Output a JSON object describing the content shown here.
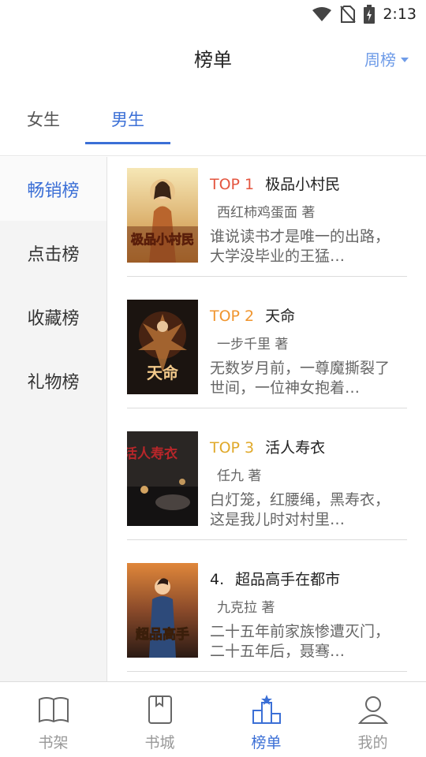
{
  "status_bar": {
    "time": "2:13"
  },
  "header": {
    "title": "榜单",
    "period": "周榜"
  },
  "gender_tabs": [
    {
      "label": "女生",
      "active": false
    },
    {
      "label": "男生",
      "active": true
    }
  ],
  "sidebar": [
    {
      "label": "畅销榜",
      "active": true
    },
    {
      "label": "点击榜",
      "active": false
    },
    {
      "label": "收藏榜",
      "active": false
    },
    {
      "label": "礼物榜",
      "active": false
    }
  ],
  "books": [
    {
      "rank": "TOP 1",
      "rank_color": "#e4553f",
      "title": "极品小村民",
      "author": "西红柿鸡蛋面 著",
      "desc": "谁说读书才是唯一的出路，大学没毕业的王猛…",
      "cover_text": "极品小村民"
    },
    {
      "rank": "TOP 2",
      "rank_color": "#f0952e",
      "title": "天命",
      "author": "一步千里 著",
      "desc": "无数岁月前，一尊魔撕裂了世间，一位神女抱着…",
      "cover_text": "天命"
    },
    {
      "rank": "TOP 3",
      "rank_color": "#e0a92a",
      "title": "活人寿衣",
      "author": "任九 著",
      "desc": "白灯笼，红腰绳，黑寿衣，这是我儿时对村里…",
      "cover_text": "活人寿衣"
    },
    {
      "rank": "4.",
      "rank_color": "#222222",
      "title": "超品高手在都市",
      "author": "九克拉 著",
      "desc": "二十五年前家族惨遭灭门，二十五年后，聂骞…",
      "cover_text": "超品高手"
    }
  ],
  "bottom_nav": [
    {
      "label": "书架",
      "icon": "bookshelf-icon",
      "active": false
    },
    {
      "label": "书城",
      "icon": "bookstore-icon",
      "active": false
    },
    {
      "label": "榜单",
      "icon": "ranking-icon",
      "active": true
    },
    {
      "label": "我的",
      "icon": "profile-icon",
      "active": false
    }
  ],
  "colors": {
    "accent": "#3b6fd6",
    "period": "#6f9ce8"
  }
}
